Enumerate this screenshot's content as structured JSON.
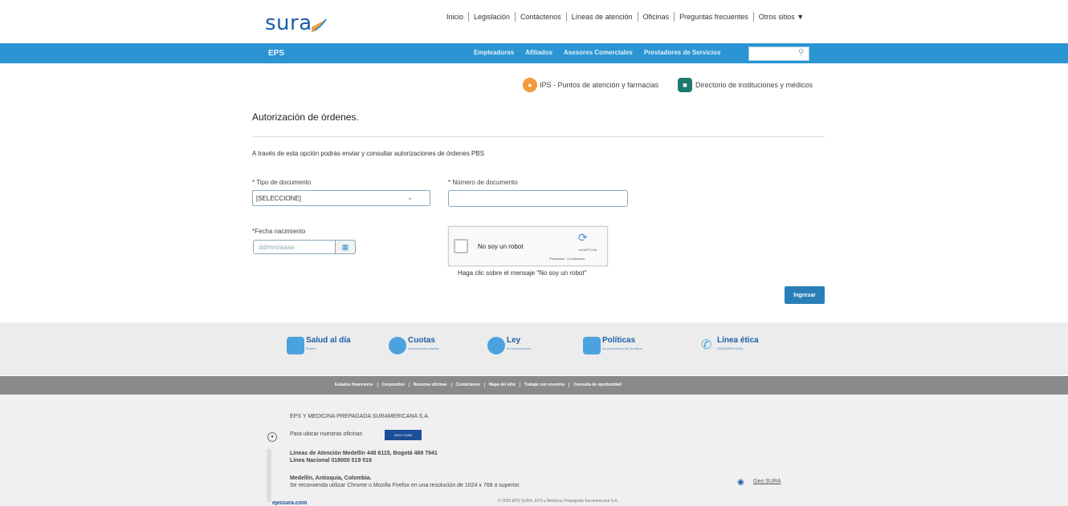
{
  "header": {
    "logo_text": "sura",
    "nav": [
      "Inicio",
      "Legislación",
      "Contáctenos",
      "Líneas de atención",
      "Oficinas",
      "Preguntas frecuentes",
      "Otros sitios"
    ],
    "dropdown_icon": "caret-down-icon"
  },
  "bluebar": {
    "section": "EPS",
    "nav": [
      "Empleadores",
      "Afiliados",
      "Asesores Comerciales",
      "Prestadores de Servicios"
    ],
    "search_icon": "search-icon",
    "color": "#2b95d3"
  },
  "sublinks": {
    "ips": "IPS - Puntos de atención y farmacias",
    "directorio": "Directorio de instituciones y médicos"
  },
  "form": {
    "title": "Autorización de órdenes.",
    "description": "A través de esta opción podrás enviar y consultar autorizaciones de órdenes PBS",
    "tipo_label": "* Tipo de documento",
    "tipo_value": "[SELECCIONE]",
    "numero_label": "* Número de documento",
    "numero_value": "",
    "fecha_label": "*Fecha nacimiento",
    "fecha_placeholder": "dd/mm/aaaa",
    "captcha_label": "No soy un robot",
    "captcha_brand": "reCAPTCHA",
    "captcha_links": "Privacidad - Condiciones",
    "hint": "Haga clic sobre el mensaje \"No soy un robot\"",
    "submit": "Ingresar"
  },
  "footer_links": [
    {
      "title": "Salud al día",
      "sub": "Boletín",
      "color": "#4aa3df"
    },
    {
      "title": "Cuotas",
      "sub": "moderadoras y tarifas",
      "color": "#4aa3df"
    },
    {
      "title": "Ley",
      "sub": "de transparencia",
      "color": "#4aa3df"
    },
    {
      "title": "Políticas",
      "sub": "de privacidad y ley de datos",
      "color": "#4aa3df"
    },
    {
      "title": "Línea ética",
      "sub": "SURAMERICANA",
      "color": "#4aa3df"
    }
  ],
  "graynav": [
    "Estados financieros",
    "Corporativo",
    "Nuestras oficinas",
    "Contáctenos",
    "Mapa del sitio",
    "Trabaje con nosotros",
    "Consulta de oportunidad"
  ],
  "footer_info": {
    "company": "EPS Y MEDICINA PREPAGADA SURAMERICANA S.A.",
    "ubicar": "Para ubicar nuestras oficinas",
    "ubicame": "INGO CASA",
    "lineas1": "Líneas de Atención Medellín 448 6115, Bogotá 489 7941",
    "lineas2": "Línea Nacional 018000 519 519",
    "ciudad": "Medellín, Antioquia, Colombia.",
    "recomendacion": "Se recomienda utilizar Chrome o Mozilla Firefox en una resolución de 1024 x 768 o superior.",
    "geo": "Geo SURA",
    "bottom_logo": "epssura.com",
    "copyright": "© 2020 EPS SURA, EPS y Medicina Prepagada Suramericana S.A."
  }
}
